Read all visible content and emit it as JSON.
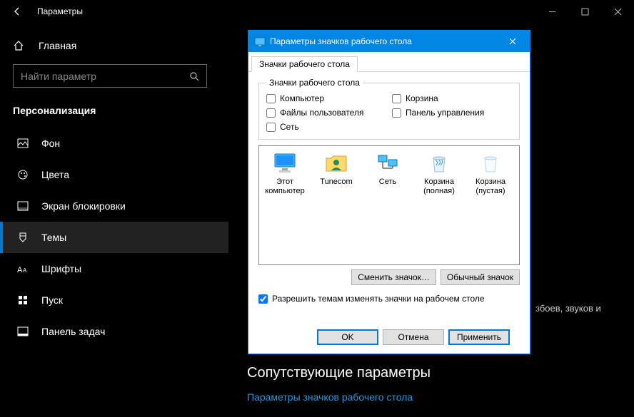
{
  "window": {
    "title": "Параметры"
  },
  "sidebar": {
    "home": "Главная",
    "search_placeholder": "Найти параметр",
    "section": "Персонализация",
    "items": [
      {
        "label": "Фон"
      },
      {
        "label": "Цвета"
      },
      {
        "label": "Экран блокировки"
      },
      {
        "label": "Темы"
      },
      {
        "label": "Шрифты"
      },
      {
        "label": "Пуск"
      },
      {
        "label": "Панель задач"
      }
    ]
  },
  "content": {
    "partial": "збоев, звуков и",
    "related_header": "Сопутствующие параметры",
    "related_link": "Параметры значков рабочего стола"
  },
  "dialog": {
    "title": "Параметры значков рабочего стола",
    "tab": "Значки рабочего стола",
    "group_legend": "Значки рабочего стола",
    "checks": [
      {
        "label": "Компьютер"
      },
      {
        "label": "Корзина"
      },
      {
        "label": "Файлы пользователя"
      },
      {
        "label": "Панель управления"
      },
      {
        "label": "Сеть"
      }
    ],
    "icons": [
      {
        "label": "Этот компьютер"
      },
      {
        "label": "Tunecom"
      },
      {
        "label": "Сеть"
      },
      {
        "label": "Корзина (полная)"
      },
      {
        "label": "Корзина (пустая)"
      }
    ],
    "change_icon": "Сменить значок…",
    "default_icon": "Обычный значок",
    "allow_themes": "Разрешить темам изменять значки на рабочем столе",
    "ok": "OK",
    "cancel": "Отмена",
    "apply": "Применить"
  }
}
